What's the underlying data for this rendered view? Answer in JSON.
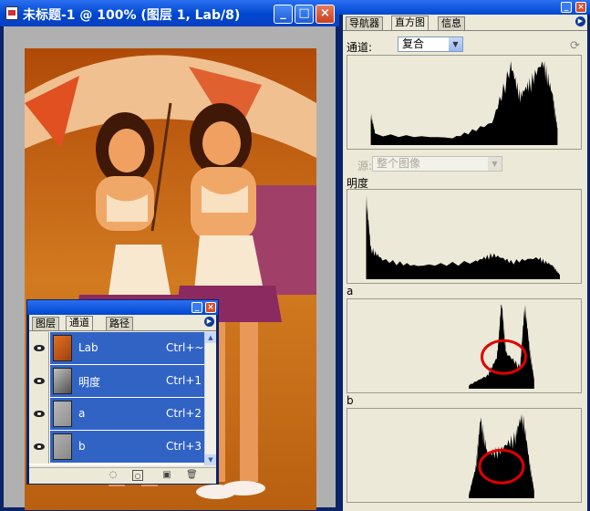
{
  "doc_window": {
    "title": "未标题-1 @ 100% (图层 1, Lab/8)",
    "minimize": "_",
    "maximize": "□",
    "close": "×"
  },
  "channels_palette": {
    "tabs": [
      "图层",
      "通道",
      "路径"
    ],
    "active_tab": "通道",
    "rows": [
      {
        "name": "Lab",
        "shortcut": "Ctrl+~",
        "thumb_color": "#c8601a"
      },
      {
        "name": "明度",
        "shortcut": "Ctrl+1",
        "thumb_color": "#8a8a8a"
      },
      {
        "name": "a",
        "shortcut": "Ctrl+2",
        "thumb_color": "#a8a8a8"
      },
      {
        "name": "b",
        "shortcut": "Ctrl+3",
        "thumb_color": "#a0a0a0"
      }
    ],
    "bottom_icons": [
      "load-selection-icon",
      "save-selection-icon",
      "new-channel-icon",
      "trash-icon"
    ]
  },
  "histogram_palette": {
    "tabs": [
      "导航器",
      "直方图",
      "信息"
    ],
    "active_tab": "直方图",
    "channel_label": "通道:",
    "channel_value": "复合",
    "source_label": "源:",
    "source_value": "整个图像",
    "panels": [
      {
        "label": "",
        "peaks": [
          [
            0.1,
            0.35
          ],
          [
            0.12,
            0.12
          ],
          [
            0.45,
            0.08
          ],
          [
            0.62,
            0.25
          ],
          [
            0.7,
            0.9
          ],
          [
            0.74,
            0.55
          ],
          [
            0.78,
            0.7
          ],
          [
            0.84,
            0.95
          ],
          [
            0.88,
            0.55
          ],
          [
            0.9,
            0.18
          ]
        ]
      },
      {
        "label": "明度",
        "peaks": [
          [
            0.08,
            0.95
          ],
          [
            0.1,
            0.35
          ],
          [
            0.15,
            0.22
          ],
          [
            0.3,
            0.15
          ],
          [
            0.55,
            0.2
          ],
          [
            0.62,
            0.28
          ],
          [
            0.7,
            0.2
          ],
          [
            0.82,
            0.24
          ],
          [
            0.88,
            0.15
          ],
          [
            0.91,
            0.05
          ]
        ]
      },
      {
        "label": "a",
        "peaks": [
          [
            0.52,
            0.04
          ],
          [
            0.6,
            0.15
          ],
          [
            0.64,
            0.35
          ],
          [
            0.66,
            0.98
          ],
          [
            0.68,
            0.4
          ],
          [
            0.74,
            0.25
          ],
          [
            0.76,
            0.98
          ],
          [
            0.78,
            0.45
          ],
          [
            0.8,
            0.1
          ]
        ]
      },
      {
        "label": "b",
        "peaks": [
          [
            0.52,
            0.04
          ],
          [
            0.55,
            0.35
          ],
          [
            0.57,
            0.9
          ],
          [
            0.6,
            0.5
          ],
          [
            0.66,
            0.55
          ],
          [
            0.72,
            0.7
          ],
          [
            0.75,
            0.98
          ],
          [
            0.78,
            0.4
          ],
          [
            0.8,
            0.08
          ]
        ]
      }
    ],
    "highlight_color": "#e00000"
  }
}
